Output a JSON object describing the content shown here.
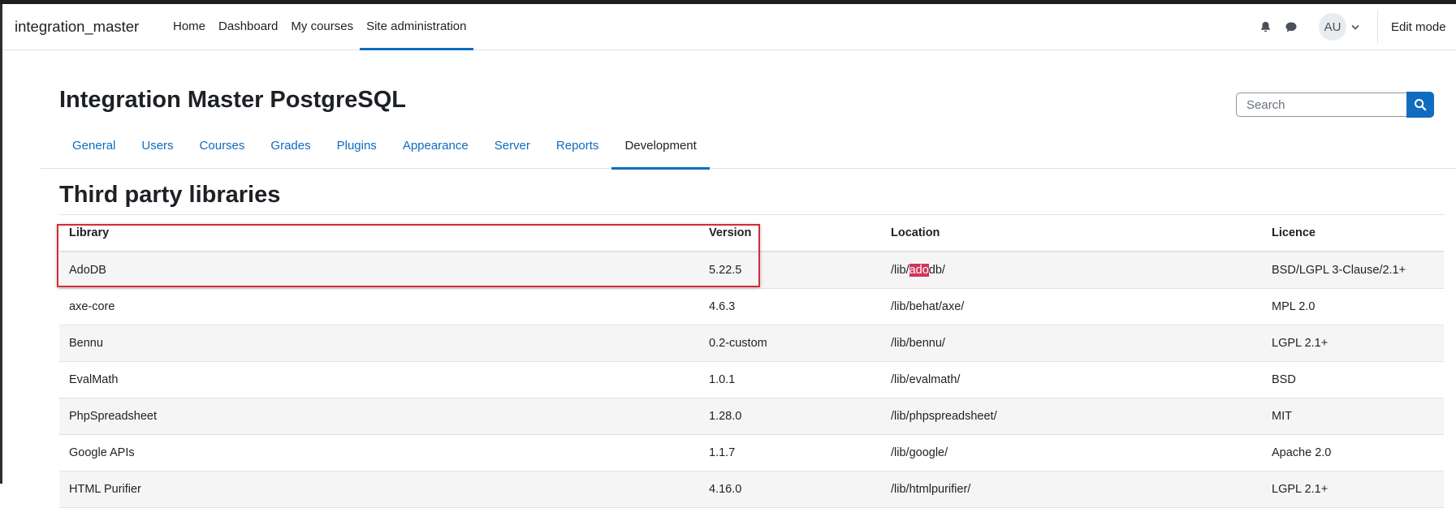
{
  "navbar": {
    "brand": "integration_master",
    "links": [
      "Home",
      "Dashboard",
      "My courses",
      "Site administration"
    ],
    "active": "Site administration",
    "avatar_initials": "AU",
    "edit_mode_label": "Edit mode"
  },
  "page": {
    "title": "Integration Master PostgreSQL",
    "search_placeholder": "Search"
  },
  "secondary_nav": {
    "tabs": [
      "General",
      "Users",
      "Courses",
      "Grades",
      "Plugins",
      "Appearance",
      "Server",
      "Reports",
      "Development"
    ],
    "active": "Development"
  },
  "content": {
    "heading": "Third party libraries"
  },
  "table": {
    "columns": [
      "Library",
      "Version",
      "Location",
      "Licence"
    ],
    "rows": [
      {
        "library": "AdoDB",
        "version": "5.22.5",
        "location_pre": "/lib/",
        "location_hl": "ado",
        "location_post": "db/",
        "licence": "BSD/LGPL 3-Clause/2.1+"
      },
      {
        "library": "axe-core",
        "version": "4.6.3",
        "location": "/lib/behat/axe/",
        "licence": "MPL 2.0"
      },
      {
        "library": "Bennu",
        "version": "0.2-custom",
        "location": "/lib/bennu/",
        "licence": "LGPL 2.1+"
      },
      {
        "library": "EvalMath",
        "version": "1.0.1",
        "location": "/lib/evalmath/",
        "licence": "BSD"
      },
      {
        "library": "PhpSpreadsheet",
        "version": "1.28.0",
        "location": "/lib/phpspreadsheet/",
        "licence": "MIT"
      },
      {
        "library": "Google APIs",
        "version": "1.1.7",
        "location": "/lib/google/",
        "licence": "Apache 2.0"
      },
      {
        "library": "HTML Purifier",
        "version": "4.16.0",
        "location": "/lib/htmlpurifier/",
        "licence": "LGPL 2.1+"
      }
    ]
  },
  "colors": {
    "link": "#0f6cbf",
    "highlight": "#d13559",
    "annotation_box": "#d42b38"
  }
}
